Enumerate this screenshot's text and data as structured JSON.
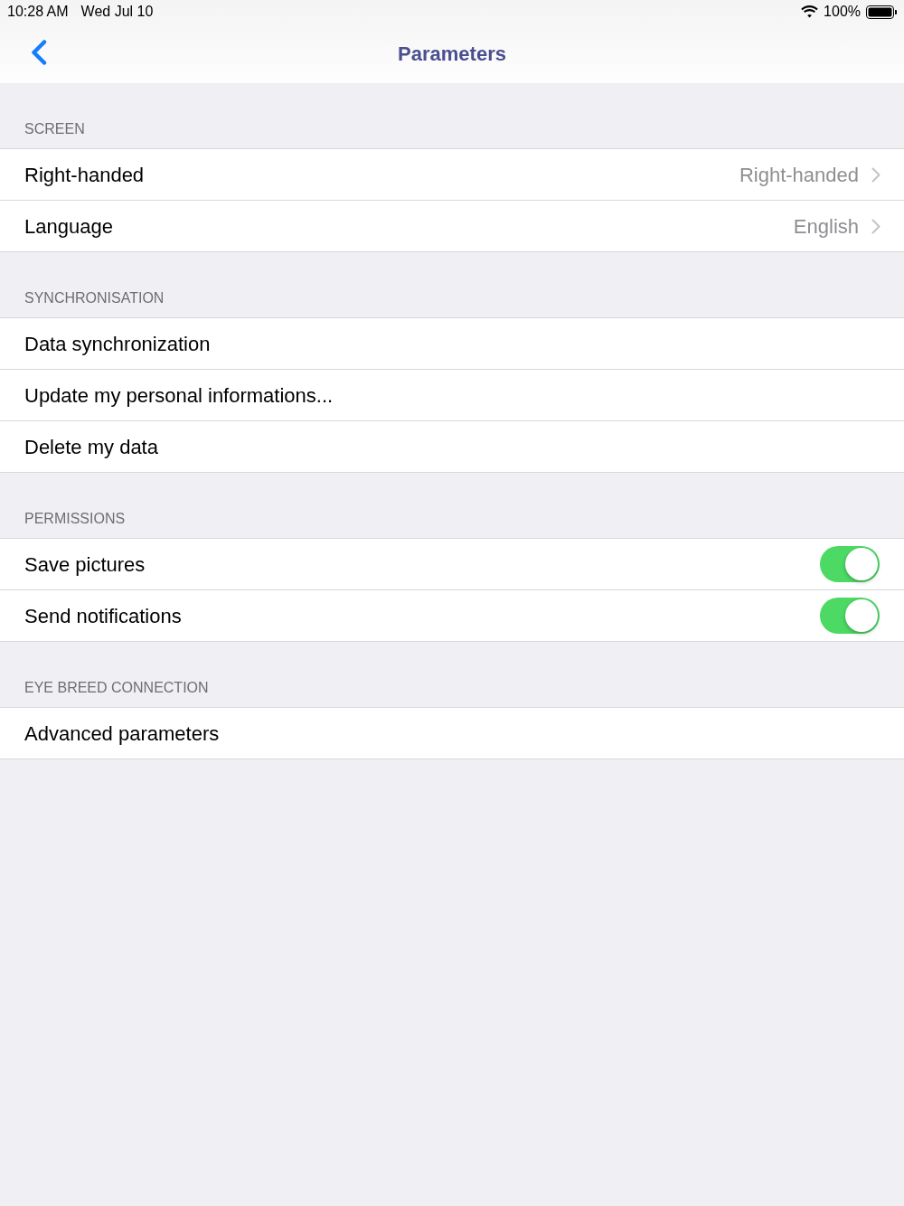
{
  "status_bar": {
    "time": "10:28 AM",
    "date": "Wed Jul 10",
    "battery": "100%"
  },
  "nav_bar": {
    "title": "Parameters"
  },
  "sections": [
    {
      "header": "SCREEN",
      "rows": [
        {
          "kind": "disclosure",
          "label": "Right-handed",
          "value": "Right-handed"
        },
        {
          "kind": "disclosure",
          "label": "Language",
          "value": "English"
        }
      ]
    },
    {
      "header": "SYNCHRONISATION",
      "rows": [
        {
          "kind": "plain",
          "label": "Data synchronization"
        },
        {
          "kind": "plain",
          "label": "Update my personal informations..."
        },
        {
          "kind": "plain",
          "label": "Delete my data"
        }
      ]
    },
    {
      "header": "PERMISSIONS",
      "rows": [
        {
          "kind": "toggle",
          "label": "Save pictures",
          "on": true
        },
        {
          "kind": "toggle",
          "label": "Send notifications",
          "on": true
        }
      ]
    },
    {
      "header": "EYE BREED CONNECTION",
      "rows": [
        {
          "kind": "plain",
          "label": "Advanced parameters"
        }
      ]
    }
  ]
}
